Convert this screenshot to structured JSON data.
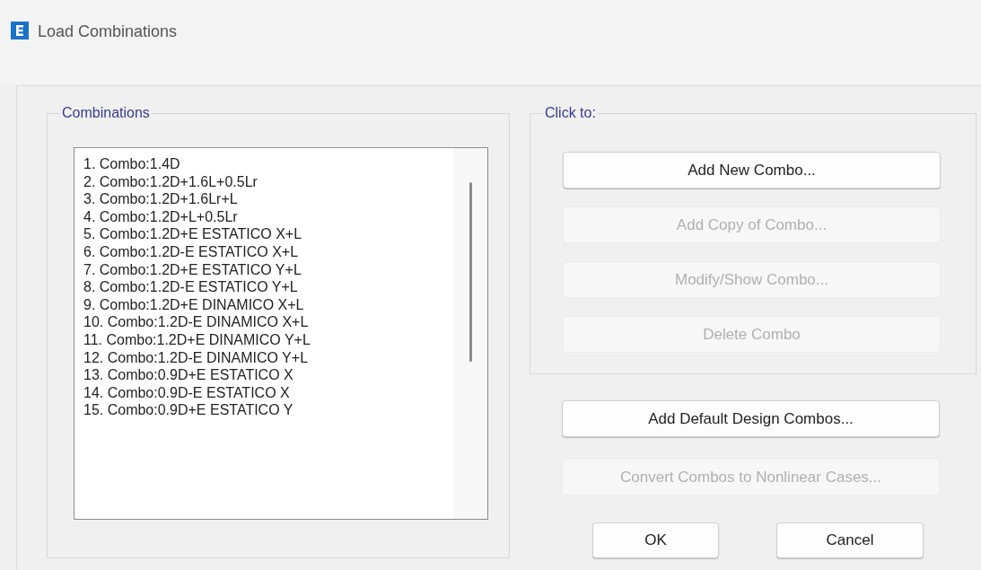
{
  "window": {
    "title": "Load Combinations"
  },
  "combinations": {
    "label": "Combinations",
    "items": [
      {
        "text": "1. Combo:1.4D",
        "selected": false
      },
      {
        "text": "2. Combo:1.2D+1.6L+0.5Lr",
        "selected": false
      },
      {
        "text": "3. Combo:1.2D+1.6Lr+L",
        "selected": false
      },
      {
        "text": "4. Combo:1.2D+L+0.5Lr",
        "selected": false
      },
      {
        "text": "5. Combo:1.2D+E ESTATICO X+L",
        "selected": false
      },
      {
        "text": "6. Combo:1.2D-E ESTATICO X+L",
        "selected": false
      },
      {
        "text": "7. Combo:1.2D+E ESTATICO Y+L",
        "selected": false
      },
      {
        "text": "8. Combo:1.2D-E ESTATICO Y+L",
        "selected": false
      },
      {
        "text": "9. Combo:1.2D+E DINAMICO X+L",
        "selected": false
      },
      {
        "text": "10. Combo:1.2D-E DINAMICO X+L",
        "selected": false
      },
      {
        "text": "11. Combo:1.2D+E DINAMICO Y+L",
        "selected": false
      },
      {
        "text": "12. Combo:1.2D-E DINAMICO Y+L",
        "selected": false
      },
      {
        "text": "13. Combo:0.9D+E ESTATICO X",
        "selected": false
      },
      {
        "text": "14. Combo:0.9D-E ESTATICO X",
        "selected": false
      },
      {
        "text": "15. Combo:0.9D+E ESTATICO Y",
        "selected": false
      }
    ]
  },
  "click_to": {
    "label": "Click to:",
    "buttons": [
      {
        "label": "Add New Combo...",
        "disabled": false
      },
      {
        "label": "Add Copy of Combo...",
        "disabled": true
      },
      {
        "label": "Modify/Show Combo...",
        "disabled": true
      },
      {
        "label": "Delete Combo",
        "disabled": true
      }
    ]
  },
  "extra_buttons": [
    {
      "label": "Add Default Design Combos...",
      "disabled": false
    },
    {
      "label": "Convert Combos to Nonlinear Cases...",
      "disabled": true
    }
  ],
  "dialog_buttons": [
    {
      "label": "OK"
    },
    {
      "label": "Cancel"
    }
  ]
}
